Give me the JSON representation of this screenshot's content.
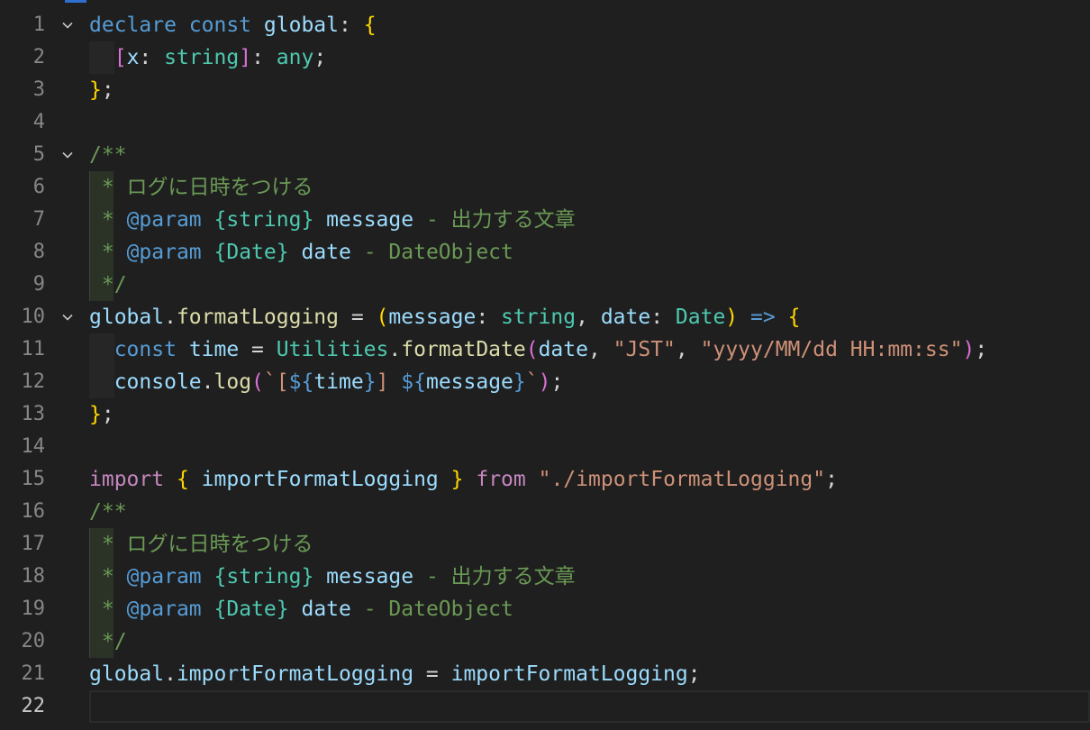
{
  "editor": {
    "lines": [
      {
        "n": "1",
        "fold": true,
        "tokens": [
          [
            "declare",
            "kw"
          ],
          [
            " ",
            "p"
          ],
          [
            "const",
            "kw"
          ],
          [
            " ",
            "p"
          ],
          [
            "global",
            "id"
          ],
          [
            ": ",
            "p"
          ],
          [
            "{",
            "b1"
          ]
        ]
      },
      {
        "n": "2",
        "indent": 1,
        "tokens": [
          [
            "[",
            "b2"
          ],
          [
            "x",
            "id"
          ],
          [
            ": ",
            "p"
          ],
          [
            "string",
            "ty"
          ],
          [
            "]",
            "b2"
          ],
          [
            ": ",
            "p"
          ],
          [
            "any",
            "ty"
          ],
          [
            ";",
            "p"
          ]
        ]
      },
      {
        "n": "3",
        "tokens": [
          [
            "}",
            "b1"
          ],
          [
            ";",
            "p"
          ]
        ]
      },
      {
        "n": "4",
        "tokens": []
      },
      {
        "n": "5",
        "fold": true,
        "tokens": [
          [
            "/**",
            "cm"
          ]
        ]
      },
      {
        "n": "6",
        "comment": true,
        "tokens": [
          [
            "* ログに日時をつける",
            "cm"
          ]
        ]
      },
      {
        "n": "7",
        "comment": true,
        "tokens": [
          [
            "* ",
            "cm"
          ],
          [
            "@param",
            "tag"
          ],
          [
            " ",
            "p"
          ],
          [
            "{string}",
            "ty"
          ],
          [
            " ",
            "p"
          ],
          [
            "message",
            "id"
          ],
          [
            " - 出力する文章",
            "cm"
          ]
        ]
      },
      {
        "n": "8",
        "comment": true,
        "tokens": [
          [
            "* ",
            "cm"
          ],
          [
            "@param",
            "tag"
          ],
          [
            " ",
            "p"
          ],
          [
            "{Date}",
            "ty"
          ],
          [
            " ",
            "p"
          ],
          [
            "date",
            "id"
          ],
          [
            " - DateObject",
            "cm"
          ]
        ]
      },
      {
        "n": "9",
        "comment": true,
        "tokens": [
          [
            "*/",
            "cm"
          ]
        ]
      },
      {
        "n": "10",
        "fold": true,
        "tokens": [
          [
            "global",
            "id"
          ],
          [
            ".",
            "p"
          ],
          [
            "formatLogging",
            "fn"
          ],
          [
            " = ",
            "p"
          ],
          [
            "(",
            "b1"
          ],
          [
            "message",
            "id"
          ],
          [
            ": ",
            "p"
          ],
          [
            "string",
            "ty"
          ],
          [
            ", ",
            "p"
          ],
          [
            "date",
            "id"
          ],
          [
            ": ",
            "p"
          ],
          [
            "Date",
            "ty"
          ],
          [
            ")",
            "b1"
          ],
          [
            " ",
            "p"
          ],
          [
            "=>",
            "kw"
          ],
          [
            " ",
            "p"
          ],
          [
            "{",
            "b1"
          ]
        ]
      },
      {
        "n": "11",
        "indent": 1,
        "tokens": [
          [
            "const",
            "kw"
          ],
          [
            " ",
            "p"
          ],
          [
            "time",
            "id"
          ],
          [
            " = ",
            "p"
          ],
          [
            "Utilities",
            "ty"
          ],
          [
            ".",
            "p"
          ],
          [
            "formatDate",
            "fn"
          ],
          [
            "(",
            "b2"
          ],
          [
            "date",
            "id"
          ],
          [
            ", ",
            "p"
          ],
          [
            "\"JST\"",
            "str"
          ],
          [
            ", ",
            "p"
          ],
          [
            "\"yyyy/MM/dd HH:mm:ss\"",
            "str"
          ],
          [
            ")",
            "b2"
          ],
          [
            ";",
            "p"
          ]
        ]
      },
      {
        "n": "12",
        "indent": 1,
        "tokens": [
          [
            "console",
            "id"
          ],
          [
            ".",
            "p"
          ],
          [
            "log",
            "fn"
          ],
          [
            "(",
            "b2"
          ],
          [
            "`[",
            "str"
          ],
          [
            "${",
            "kw"
          ],
          [
            "time",
            "id"
          ],
          [
            "}",
            "kw"
          ],
          [
            "] ",
            "str"
          ],
          [
            "${",
            "kw"
          ],
          [
            "message",
            "id"
          ],
          [
            "}",
            "kw"
          ],
          [
            "`",
            "str"
          ],
          [
            ")",
            "b2"
          ],
          [
            ";",
            "p"
          ]
        ]
      },
      {
        "n": "13",
        "tokens": [
          [
            "}",
            "b1"
          ],
          [
            ";",
            "p"
          ]
        ]
      },
      {
        "n": "14",
        "tokens": []
      },
      {
        "n": "15",
        "tokens": [
          [
            "import",
            "kw2"
          ],
          [
            " ",
            "p"
          ],
          [
            "{",
            "b1"
          ],
          [
            " ",
            "p"
          ],
          [
            "importFormatLogging",
            "id"
          ],
          [
            " ",
            "p"
          ],
          [
            "}",
            "b1"
          ],
          [
            " ",
            "p"
          ],
          [
            "from",
            "kw2"
          ],
          [
            " ",
            "p"
          ],
          [
            "\"./importFormatLogging\"",
            "str"
          ],
          [
            ";",
            "p"
          ]
        ]
      },
      {
        "n": "16",
        "tokens": [
          [
            "/**",
            "cm"
          ]
        ]
      },
      {
        "n": "17",
        "comment": true,
        "tokens": [
          [
            "* ログに日時をつける",
            "cm"
          ]
        ]
      },
      {
        "n": "18",
        "comment": true,
        "tokens": [
          [
            "* ",
            "cm"
          ],
          [
            "@param",
            "tag"
          ],
          [
            " ",
            "p"
          ],
          [
            "{string}",
            "ty"
          ],
          [
            " ",
            "p"
          ],
          [
            "message",
            "id"
          ],
          [
            " - 出力する文章",
            "cm"
          ]
        ]
      },
      {
        "n": "19",
        "comment": true,
        "tokens": [
          [
            "* ",
            "cm"
          ],
          [
            "@param",
            "tag"
          ],
          [
            " ",
            "p"
          ],
          [
            "{Date}",
            "ty"
          ],
          [
            " ",
            "p"
          ],
          [
            "date",
            "id"
          ],
          [
            " - DateObject",
            "cm"
          ]
        ]
      },
      {
        "n": "20",
        "comment": true,
        "tokens": [
          [
            "*/",
            "cm"
          ]
        ]
      },
      {
        "n": "21",
        "tokens": [
          [
            "global",
            "id"
          ],
          [
            ".",
            "p"
          ],
          [
            "importFormatLogging",
            "id"
          ],
          [
            " = ",
            "p"
          ],
          [
            "importFormatLogging",
            "id"
          ],
          [
            ";",
            "p"
          ]
        ]
      },
      {
        "n": "22",
        "current": true,
        "tokens": []
      }
    ]
  }
}
